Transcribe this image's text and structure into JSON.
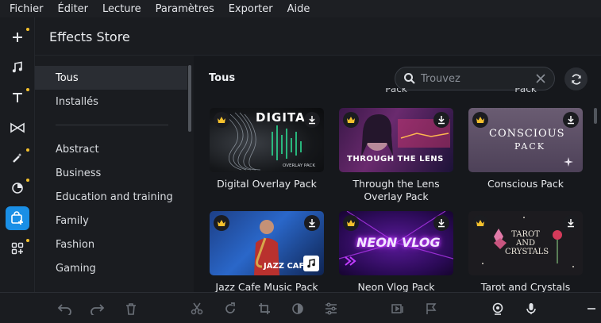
{
  "menu": [
    "Fichier",
    "Éditer",
    "Lecture",
    "Paramètres",
    "Exporter",
    "Aide"
  ],
  "store_title": "Effects Store",
  "categories": {
    "top": [
      "Tous",
      "Installés"
    ],
    "list": [
      "Abstract",
      "Business",
      "Education and training",
      "Family",
      "Fashion",
      "Gaming"
    ]
  },
  "section_title": "Tous",
  "search": {
    "placeholder": "Trouvez"
  },
  "peek_labels": [
    "Pack",
    "Pack"
  ],
  "cards": [
    {
      "title": "Digital Overlay Pack",
      "thumb_text": "DIGITA",
      "thumb_sub": "OVERLAY PACK"
    },
    {
      "title": "Through the Lens Overlay Pack",
      "thumb_text": "THROUGH THE LENS"
    },
    {
      "title": "Conscious Pack",
      "thumb_text": "CONSCIOUS",
      "thumb_sub": "PACK"
    },
    {
      "title": "Jazz Cafe Music Pack",
      "thumb_text": "JAZZ CAFE"
    },
    {
      "title": "Neon Vlog Pack",
      "thumb_text": "NEON VLOG"
    },
    {
      "title": "Tarot and Crystals",
      "thumb_text": "TAROT AND CRYSTALS",
      "thumb_lines": [
        "TAROT",
        "AND",
        "CRYSTALS"
      ]
    }
  ],
  "colors": {
    "accent": "#1a8fe6",
    "premium": "#f5c12d",
    "neon": "#c13cff"
  }
}
